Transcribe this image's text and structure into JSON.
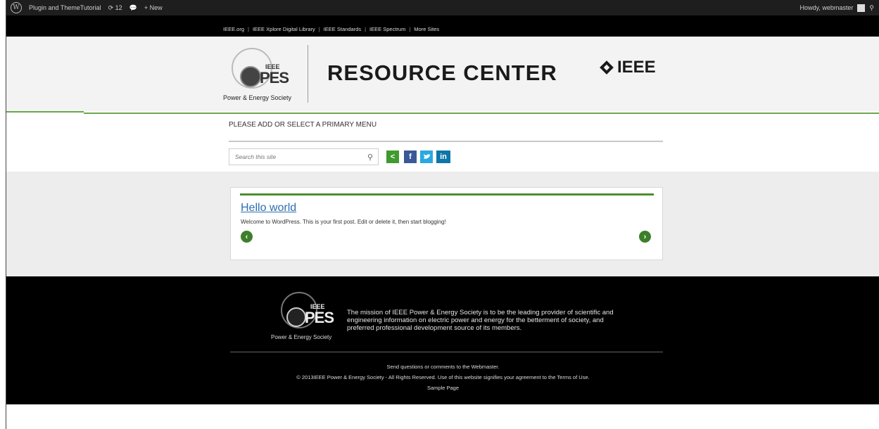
{
  "admin_bar": {
    "site_name": "Plugin and ThemeTutorial",
    "updates_count": "12",
    "new_label": "+ New",
    "howdy": "Howdy, webmaster"
  },
  "top_links": [
    "IEEE.org",
    "IEEE Xplore Digital Library",
    "IEEE Standards",
    "IEEE Spectrum",
    "More Sites"
  ],
  "header": {
    "logo_ieee": "IEEE",
    "logo_pes": "PES",
    "logo_subtitle": "Power & Energy Society",
    "title": "RESOURCE CENTER",
    "brand": "IEEE"
  },
  "menu": {
    "notice": "PLEASE ADD OR SELECT A PRIMARY MENU"
  },
  "search": {
    "placeholder": "Search this site"
  },
  "share": {
    "share_icon": "share-icon",
    "facebook": "f",
    "twitter": "twitter-icon",
    "linkedin": "in",
    "colors": {
      "share": "#3f9b2e",
      "facebook": "#3b5998",
      "twitter": "#2aa9e0",
      "linkedin": "#0e76a8"
    }
  },
  "post": {
    "title": "Hello world",
    "excerpt": "Welcome to WordPress. This is your first post. Edit or delete it, then start blogging!"
  },
  "footer": {
    "logo_ieee": "IEEE",
    "logo_pes": "PES",
    "logo_subtitle": "Power & Energy Society",
    "mission": "The mission of IEEE Power & Energy Society is to be the leading provider of scientific and engineering information on electric power and energy for the betterment of society, and preferred professional development source of its members.",
    "contact": "Send questions or comments to the Webmaster.",
    "copyright": "© 2013IEEE Power & Energy Society - All Rights Reserved. Use of this website signifies your agreement to the Terms of Use.",
    "sample_page": "Sample Page"
  },
  "colors": {
    "accent_green": "#4e8d2f",
    "link_blue": "#2d6fb0"
  }
}
